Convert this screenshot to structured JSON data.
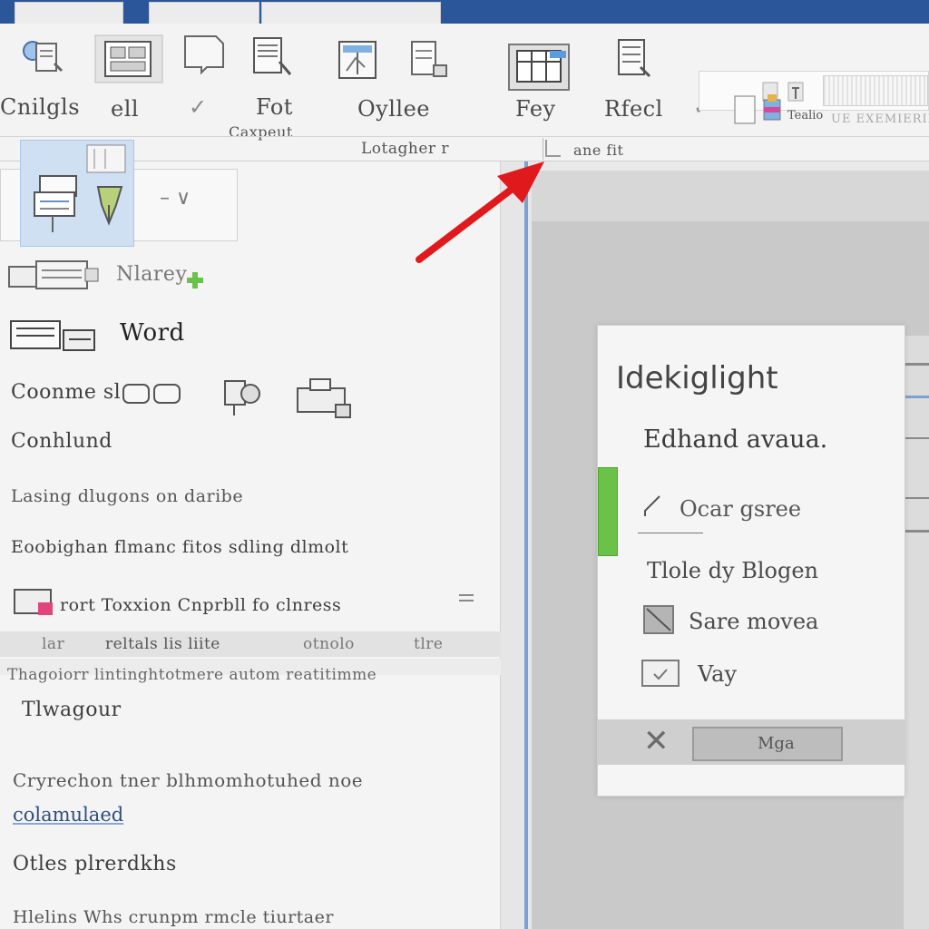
{
  "ribbon": {
    "labels": [
      "Cnilgls",
      "ell",
      "Fot",
      "Oyllee",
      "Fey",
      "Rfecl"
    ],
    "sublabel_1": "Caxpeut",
    "group_label_1": "Lotagher r",
    "group_label_2": "ane fit",
    "field_text": "Tealio",
    "faint_text": "UE EXEMIERIEK"
  },
  "left_pane": {
    "item_1": "Nlarey",
    "item_2": "Word",
    "item_3": "Coonme sl",
    "item_4": "Conhlund",
    "item_5": "Lasing dlugons on daribe",
    "item_6": "Eoobighan flmanc fitos sdling dlmolt",
    "item_7": "rort Toxxion Cnprbll fo clnress",
    "row_band_left": "lar",
    "row_band_mid": "reltals lis liite",
    "row_band_right": "otnolo",
    "row_band_far": "tlre",
    "row_text_2": "Thagoiorr lintinghtotmere autom reatitimme",
    "item_8": "Tlwagour",
    "item_9": "Cryrechon tner blhmomhotuhed noe",
    "link_text": "colamulaed",
    "item_10": "Otles plrerdkhs",
    "item_11": "Hlelins Whs crunpm rmcle tiurtaer"
  },
  "dialog": {
    "title": "Idekiglight",
    "line_1": "Edhand avaua.",
    "line_2": "Ocar gsree",
    "line_3": "Tlole dy Blogen",
    "check_1": "Sare movea",
    "check_2": "Vay",
    "button_label": "Mga",
    "close_symbol": "✕"
  },
  "colors": {
    "title_bar": "#2b579a",
    "accent_green": "#6bc24a",
    "annotation_red": "#e0191c",
    "selection_blue": "#cfe0f3"
  }
}
